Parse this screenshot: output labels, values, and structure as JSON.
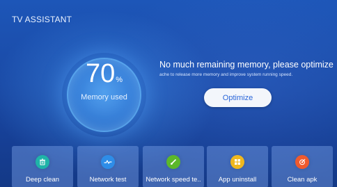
{
  "app": {
    "title": "TV ASSISTANT"
  },
  "memory": {
    "value": "70",
    "unit": "%",
    "label": "Memory used",
    "used_fraction": 0.7
  },
  "message": {
    "title": "No much remaining memory, please optimize",
    "subtitle": "ache to release more memory and improve system running speed."
  },
  "optimize": {
    "label": "Optimize"
  },
  "tiles": [
    {
      "label": "Deep clean",
      "icon": "trash-icon",
      "color": "#1fb4a8"
    },
    {
      "label": "Network test",
      "icon": "pulse-icon",
      "color": "#2e8de8"
    },
    {
      "label": "Network speed te..",
      "icon": "speed-icon",
      "color": "#5cb82a"
    },
    {
      "label": "App uninstall",
      "icon": "grid-icon",
      "color": "#f0b81e"
    },
    {
      "label": "Clean apk",
      "icon": "target-icon",
      "color": "#ef5a2e"
    }
  ],
  "colors": {
    "background": "#1a4aa6",
    "accent": "#2a66d9"
  }
}
